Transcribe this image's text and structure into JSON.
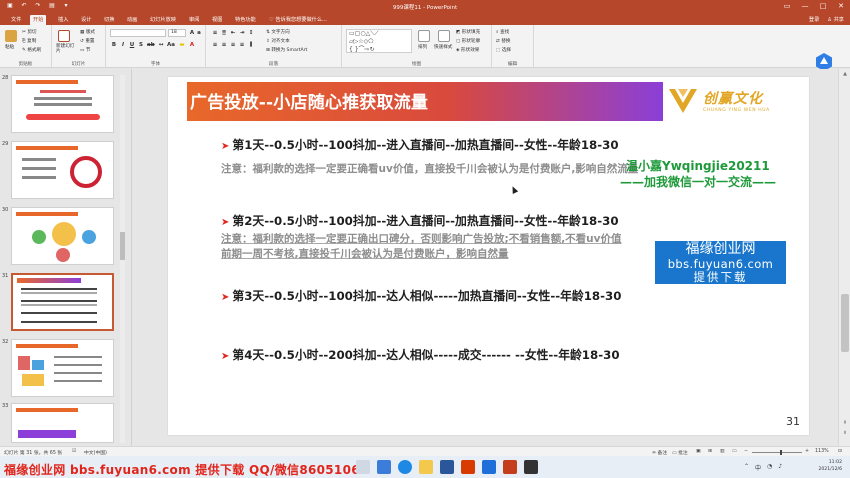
{
  "window": {
    "title": "999课程11 - PowerPoint",
    "controls": [
      "—",
      "□",
      "✕"
    ]
  },
  "ribbon_tabs": {
    "items": [
      "文件",
      "开始",
      "插入",
      "设计",
      "切换",
      "动画",
      "幻灯片放映",
      "审阅",
      "视图",
      "特色功能"
    ],
    "tell_me": "告诉我您想要做什么...",
    "login": "登录",
    "share": "共享"
  },
  "ribbon": {
    "paste": "粘贴",
    "cut": "剪切",
    "copy": "复制",
    "format_painter": "格式刷",
    "new_slide": "新建幻灯片",
    "layout": "版式",
    "reset": "重置",
    "section": "节",
    "font_size": "18",
    "text_direction": "文字方向",
    "align_text": "对齐文本",
    "convert_smartart": "转换为 SmartArt",
    "arrange": "排列",
    "quick_styles": "快速样式",
    "shape_fill": "形状填充",
    "shape_outline": "形状轮廓",
    "shape_effects": "形状效果",
    "find": "查找",
    "replace": "替换",
    "select": "选择",
    "groups": {
      "clipboard": "剪贴板",
      "slides": "幻灯片",
      "font": "字体",
      "paragraph": "段落",
      "drawing": "绘图",
      "editing": "编辑"
    }
  },
  "thumbnails": {
    "numbers": [
      "28",
      "29",
      "30",
      "31",
      "32",
      "33"
    ],
    "selected": "31"
  },
  "slide": {
    "title": "广告投放--小店随心推获取流量",
    "logo_name": "创赢文化",
    "logo_sub": "CHUANG YING WEN HUA",
    "day1": "第1天--0.5小时--100抖加--进入直播间--加热直播间--女性--年龄18-30",
    "note1": "注意：福利款的选择一定要正确看uv价值，直接投千川会被认为是付费账户,影响自然流量",
    "day2": "第2天--0.5小时--100抖加--进入直播间--加热直播间--女性--年龄18-30",
    "note2a": "注意：福利款的选择一定要正确出口碑分，否则影响广告投放;不看销售额,不看uv价值",
    "note2b": "前期一周不考核,直接投千川会被认为是付费账户，影响自然量",
    "day3": "第3天--0.5小时--100抖加--达人相似-----加热直播间--女性--年龄18-30",
    "day4": "第4天--0.5小时--200抖加--达人相似-----成交------ --女性--年龄18-30",
    "page_number": "31",
    "watermark_green1": "温小嘉Ywqingjie20211",
    "watermark_green2": "——加我微信一对一交流——",
    "blue_box": [
      "福缘创业网",
      "bbs.fuyuan6.com",
      "提供下载"
    ]
  },
  "statusbar": {
    "slide_info": "幻灯片 第 31 张，共 65 张",
    "language": "中文(中国)",
    "notes": "备注",
    "comments": "批注",
    "zoom": "113%"
  },
  "bottom_watermark": "福缘创业网 bbs.fuyuan6.com 提供下载 QQ/微信86051064",
  "tray": {
    "time": "11:02",
    "date": "2021/12/6"
  },
  "colors": {
    "ppt_accent": "#b7472a",
    "day_arrow": "#e02a1f",
    "watermark_red": "#e1251b",
    "watermark_green": "#1f9a3a",
    "blue_box": "#1976cc",
    "logo_gold": "#e2a626"
  }
}
